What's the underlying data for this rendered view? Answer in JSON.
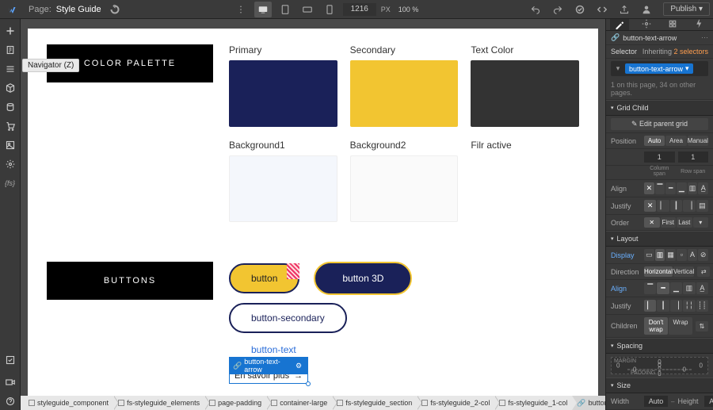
{
  "topbar": {
    "page_label": "Page:",
    "page_title": "Style Guide",
    "width_value": "1216",
    "width_unit": "PX",
    "zoom": "100 %",
    "publish_label": "Publish"
  },
  "tooltip": {
    "text": "Navigator (Z)"
  },
  "canvas": {
    "palette_title": "COLOR PALETTE",
    "swatches": [
      {
        "label": "Primary",
        "class": "primary",
        "hex": "#1a2159"
      },
      {
        "label": "Secondary",
        "class": "secondary",
        "hex": "#f2c531"
      },
      {
        "label": "Text Color",
        "class": "textc",
        "hex": "#333333"
      },
      {
        "label": "Background1",
        "class": "bg1",
        "hex": "#f4f7fc"
      },
      {
        "label": "Background2",
        "class": "bg2",
        "hex": "#fafafa"
      },
      {
        "label": "Filr active",
        "class": "filractive",
        "hex": ""
      }
    ],
    "buttons_title": "BUTTONS",
    "btn_primary": "button",
    "btn_3d": "button 3D",
    "btn_secondary": "button-secondary",
    "btn_text": "button-text",
    "selected_badge": "button-text-arrow",
    "btn_arrow_text": "En savoir plus",
    "btn_arrow_glyph": "→"
  },
  "breadcrumb": [
    {
      "label": "styleguide_component",
      "icon": "box"
    },
    {
      "label": "fs-styleguide_elements",
      "icon": "box"
    },
    {
      "label": "page-padding",
      "icon": "box"
    },
    {
      "label": "container-large",
      "icon": "box"
    },
    {
      "label": "fs-styleguide_section",
      "icon": "box"
    },
    {
      "label": "fs-styleguide_2-col",
      "icon": "box"
    },
    {
      "label": "fs-styleguide_1-col",
      "icon": "box"
    },
    {
      "label": "button-text-arrow",
      "icon": "link"
    }
  ],
  "right": {
    "selected_class": "button-text-arrow",
    "selector_label": "Selector",
    "inheriting_text": "Inheriting",
    "inheriting_count": "2 selectors",
    "usage_text": "1 on this page, 34 on other pages.",
    "sections": {
      "grid_child": {
        "title": "Grid Child",
        "edit_parent": "Edit parent grid",
        "position_label": "Position",
        "position_opts": [
          "Auto",
          "Area",
          "Manual"
        ],
        "col_val": "1",
        "row_val": "1",
        "col_span_label": "Column span",
        "row_span_label": "Row span",
        "align_label": "Align",
        "justify_label": "Justify",
        "order_label": "Order",
        "order_opts": [
          "First",
          "Last"
        ]
      },
      "layout": {
        "title": "Layout",
        "display_label": "Display",
        "direction_label": "Direction",
        "direction_opts": [
          "Horizontal",
          "Vertical"
        ],
        "align_label": "Align",
        "justify_label": "Justify",
        "children_label": "Children",
        "children_opts": [
          "Don't wrap",
          "Wrap"
        ]
      },
      "spacing": {
        "title": "Spacing",
        "margin_label": "MARGIN",
        "padding_label": "PADDING",
        "zero": "0"
      },
      "size": {
        "title": "Size",
        "width_label": "Width",
        "height_label": "Height",
        "auto": "Auto"
      }
    }
  }
}
